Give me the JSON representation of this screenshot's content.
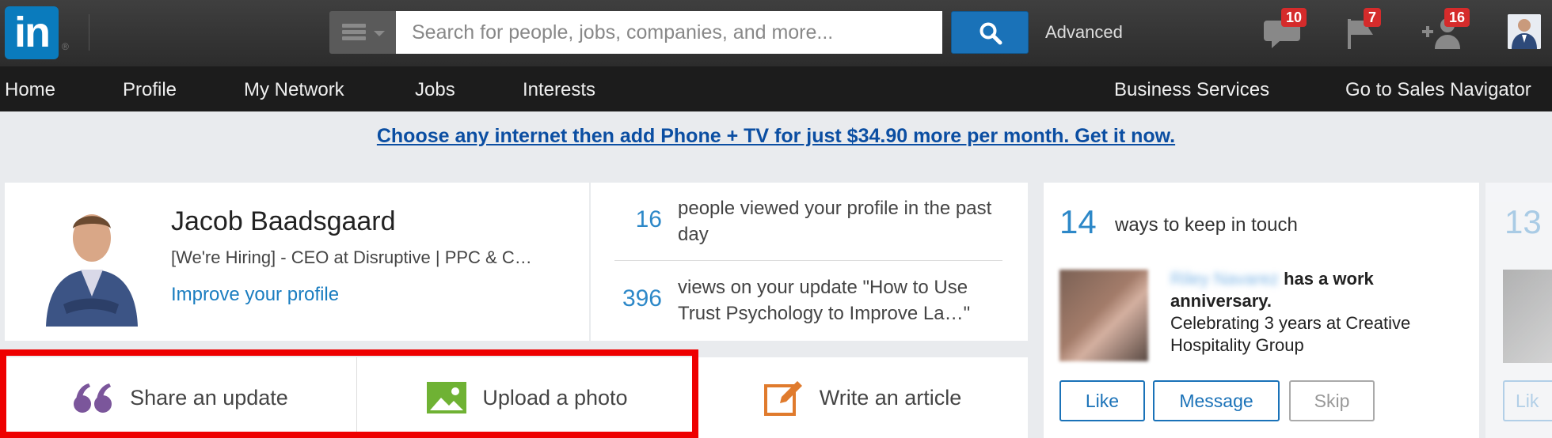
{
  "topbar": {
    "logo_text": "in",
    "logo_reg": "®",
    "search_placeholder": "Search for people, jobs, companies, and more...",
    "advanced_label": "Advanced",
    "notifications": [
      {
        "icon": "messages-icon",
        "count": "10"
      },
      {
        "icon": "flag-icon",
        "count": "7"
      },
      {
        "icon": "add-connection-icon",
        "count": "16"
      }
    ]
  },
  "nav": {
    "items": [
      "Home",
      "Profile",
      "My Network",
      "Jobs",
      "Interests"
    ],
    "right_items": [
      "Business Services",
      "Go to Sales Navigator"
    ]
  },
  "promo": {
    "text": "Choose any internet then add Phone + TV for just $34.90 more per month. Get it now."
  },
  "profile": {
    "name": "Jacob Baadsgaard",
    "headline": "[We're Hiring] - CEO at Disruptive | PPC & C…",
    "improve_link": "Improve your profile"
  },
  "stats": [
    {
      "number": "16",
      "text": "people viewed your profile in the past day"
    },
    {
      "number": "396",
      "text": "views on your update \"How to Use Trust Psychology to Improve La…\""
    }
  ],
  "actions": {
    "share": "Share an update",
    "upload": "Upload a photo",
    "article": "Write an article"
  },
  "keep_in_touch": {
    "number": "14",
    "text": "ways to keep in touch",
    "person_name": "Riley Navarez",
    "anniversary_bold": "has a work anniversary.",
    "anniversary_detail": "Celebrating 3 years at Creative Hospitality Group",
    "like": "Like",
    "message": "Message",
    "skip": "Skip"
  },
  "peek": {
    "number": "13",
    "button": "Lik"
  },
  "colors": {
    "accent": "#1a72b8",
    "highlight": "#ee0000",
    "badge": "#d52b2b"
  }
}
